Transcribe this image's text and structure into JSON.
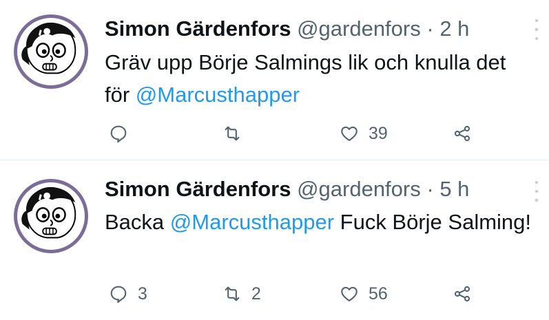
{
  "tweets": [
    {
      "author": {
        "name": "Simon Gärdenfors",
        "handle": "@gardenfors"
      },
      "separator": "·",
      "time": "2 h",
      "text_parts": [
        "Gräv upp Börje Salmings lik och knulla det för ",
        "@Marcusthapper",
        ""
      ],
      "actions": {
        "reply_count": "",
        "retweet_count": "",
        "like_count": "39"
      },
      "avatar_icon": "cartoon-face-avatar",
      "more_icon": "more-vertical-icon"
    },
    {
      "author": {
        "name": "Simon Gärdenfors",
        "handle": "@gardenfors"
      },
      "separator": "·",
      "time": "5 h",
      "text_parts": [
        "Backa ",
        "@Marcusthapper",
        " Fuck Börje Salming!"
      ],
      "actions": {
        "reply_count": "3",
        "retweet_count": "2",
        "like_count": "56"
      },
      "avatar_icon": "cartoon-face-avatar",
      "more_icon": "more-vertical-icon"
    }
  ],
  "colors": {
    "text": "#0f1419",
    "secondary": "#536471",
    "mention": "#1d9bf0",
    "avatar_ring": "#7b6c98",
    "divider": "#e6ecf0"
  }
}
